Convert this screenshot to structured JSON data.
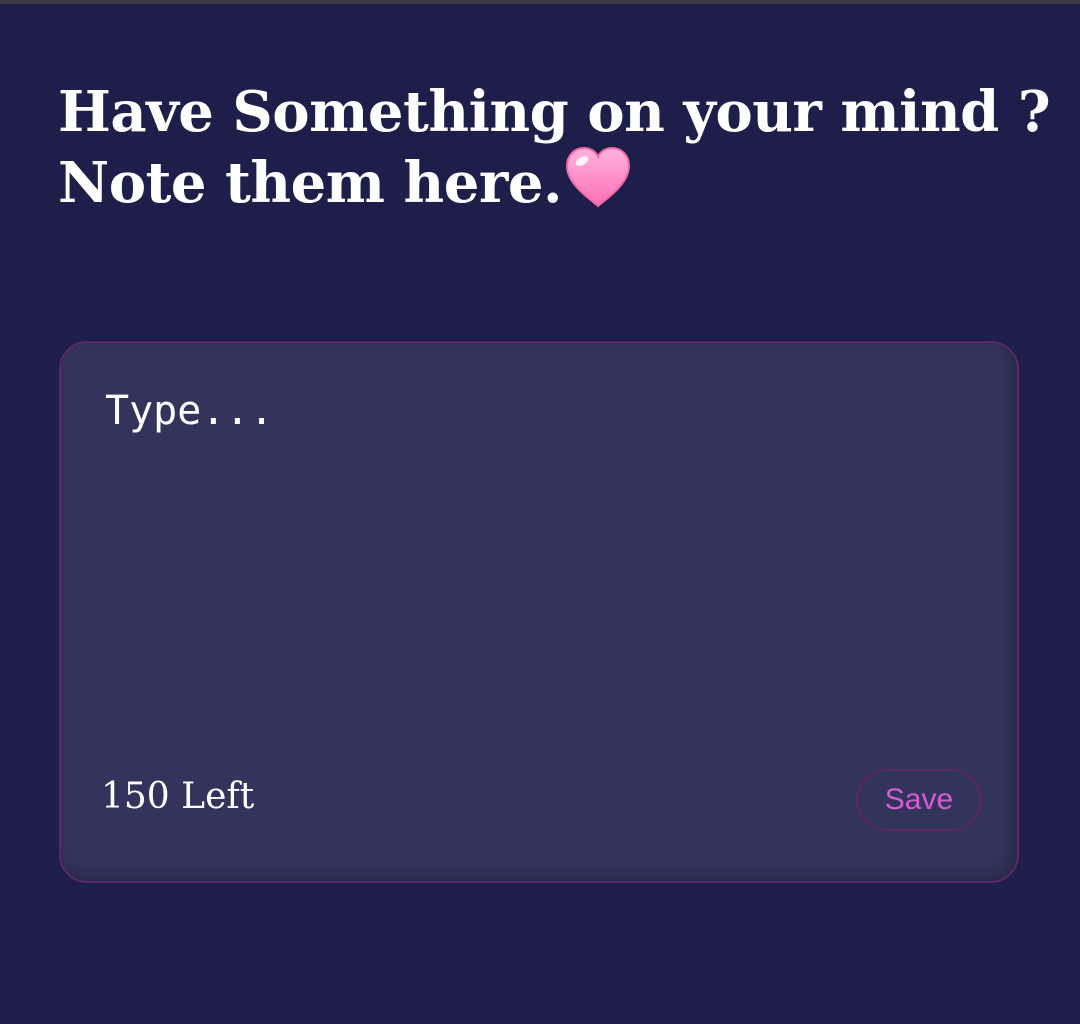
{
  "header": {
    "line1": "Have Something on your mind ?",
    "line2": "Note them here.",
    "heart_icon": "pink-heart-icon"
  },
  "note": {
    "placeholder": "Type...",
    "value": "",
    "chars_left": "150 Left",
    "save_label": "Save"
  },
  "colors": {
    "background": "#1d1e4a",
    "card": "#33345b",
    "border": "#5e2466",
    "accent": "#d45bd4",
    "heart": "#ff8dc8"
  }
}
